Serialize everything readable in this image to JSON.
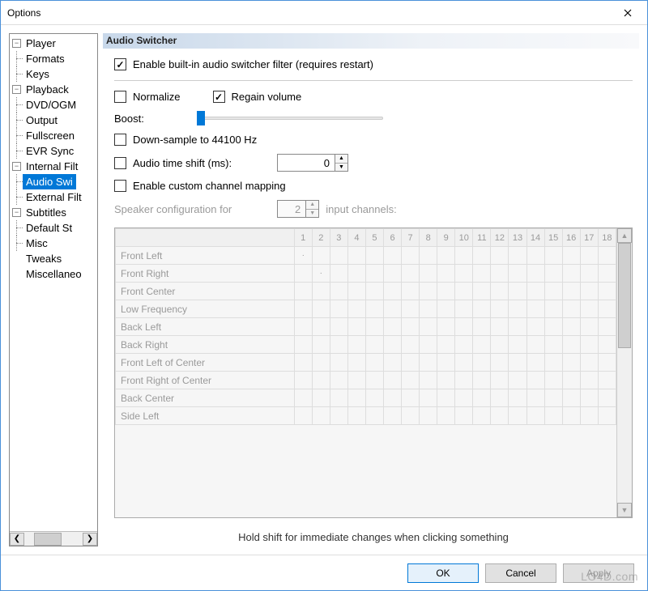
{
  "window": {
    "title": "Options"
  },
  "tree": [
    {
      "label": "Player",
      "toggle": "-",
      "depth": 0
    },
    {
      "label": "Formats",
      "depth": 1
    },
    {
      "label": "Keys",
      "depth": 1
    },
    {
      "label": "Playback",
      "toggle": "-",
      "depth": 0
    },
    {
      "label": "DVD/OGM",
      "depth": 1
    },
    {
      "label": "Output",
      "depth": 1
    },
    {
      "label": "Fullscreen",
      "depth": 1
    },
    {
      "label": "EVR Sync",
      "depth": 1
    },
    {
      "label": "Internal Filt",
      "toggle": "-",
      "depth": 0
    },
    {
      "label": "Audio Swi",
      "depth": 1,
      "selected": true
    },
    {
      "label": "External Filt",
      "depth": 1
    },
    {
      "label": "Subtitles",
      "toggle": "-",
      "depth": 0
    },
    {
      "label": "Default St",
      "depth": 1
    },
    {
      "label": "Misc",
      "depth": 1
    },
    {
      "label": "Tweaks",
      "depth": 0
    },
    {
      "label": "Miscellaneo",
      "depth": 0
    }
  ],
  "panel": {
    "title": "Audio Switcher",
    "enable_label": "Enable built-in audio switcher filter (requires restart)",
    "enable_checked": true,
    "normalize_label": "Normalize",
    "normalize_checked": false,
    "regain_label": "Regain volume",
    "regain_checked": true,
    "boost_label": "Boost:",
    "downsample_label": "Down-sample to 44100 Hz",
    "downsample_checked": false,
    "timeshift_label": "Audio time shift (ms):",
    "timeshift_checked": false,
    "timeshift_value": "0",
    "custommap_label": "Enable custom channel mapping",
    "custommap_checked": false,
    "speaker_pre": "Speaker configuration for",
    "speaker_value": "2",
    "speaker_post": "input channels:",
    "matrix_cols": [
      "1",
      "2",
      "3",
      "4",
      "5",
      "6",
      "7",
      "8",
      "9",
      "10",
      "11",
      "12",
      "13",
      "14",
      "15",
      "16",
      "17",
      "18"
    ],
    "matrix_rows": [
      "Front Left",
      "Front Right",
      "Front Center",
      "Low Frequency",
      "Back Left",
      "Back Right",
      "Front Left of Center",
      "Front Right of Center",
      "Back Center",
      "Side Left"
    ],
    "hint": "Hold shift for immediate changes when clicking something"
  },
  "footer": {
    "ok": "OK",
    "cancel": "Cancel",
    "apply": "Apply"
  },
  "watermark": "LO4D.com"
}
